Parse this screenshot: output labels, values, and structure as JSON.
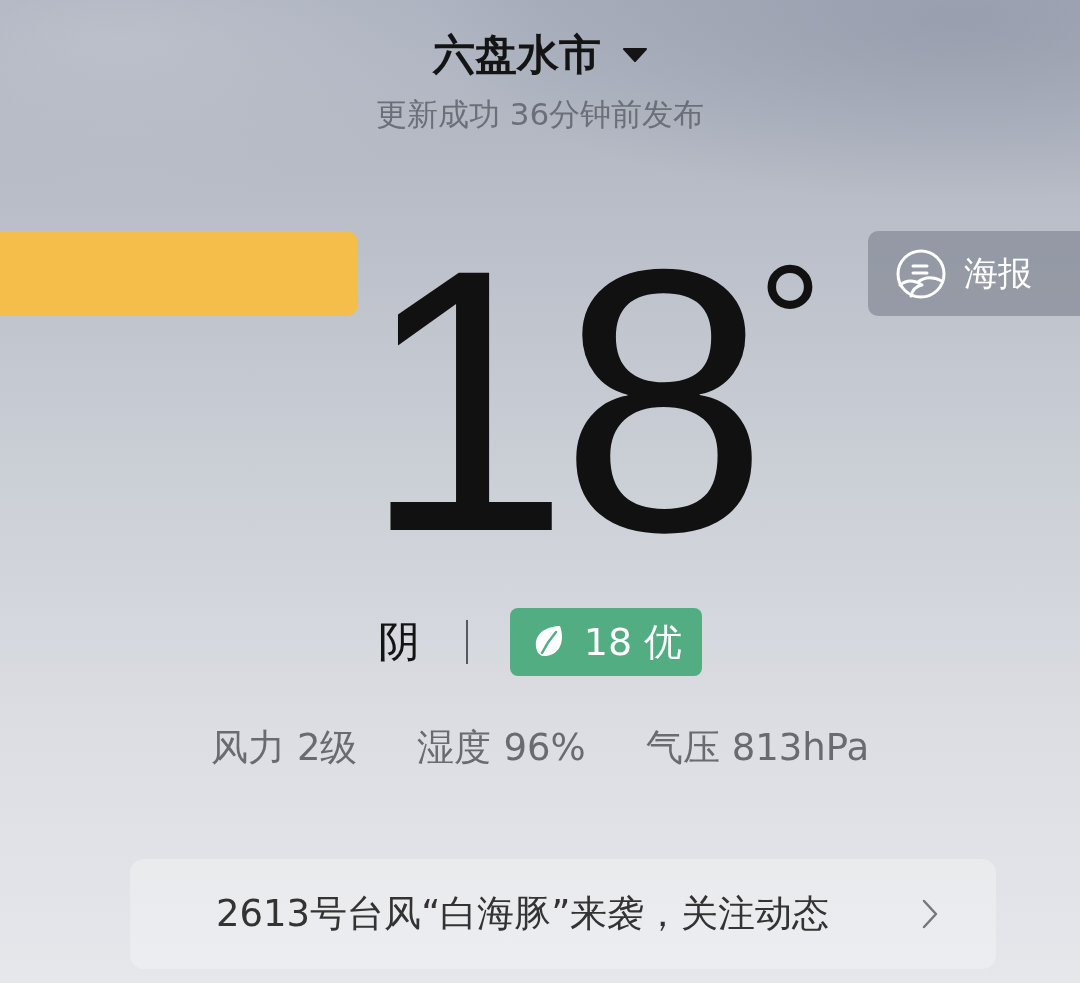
{
  "location": {
    "city": "六盘水市",
    "status": "更新成功 36分钟前发布"
  },
  "poster_button": {
    "label": "海报"
  },
  "temperature": {
    "value": "18",
    "unit": "°"
  },
  "condition": "阴",
  "air_quality": {
    "label": "18 优"
  },
  "stats": [
    {
      "label": "风力",
      "value": "2级"
    },
    {
      "label": "湿度",
      "value": "96%"
    },
    {
      "label": "气压",
      "value": "813hPa"
    }
  ],
  "alert": {
    "text": "2613号台风“白海豚”来袭，关注动态"
  }
}
